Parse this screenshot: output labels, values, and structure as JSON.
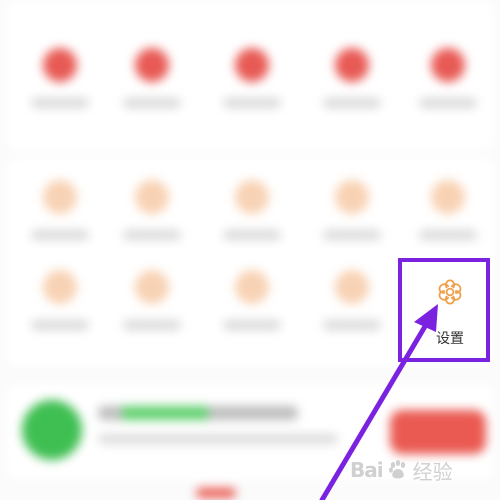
{
  "settings": {
    "label": "设置",
    "icon": "gear-flower-icon",
    "icon_color": "#f0a04b"
  },
  "highlight": {
    "color": "#7b22e0"
  },
  "watermark": {
    "logo_text": "Bai",
    "logo_suffix": "经验",
    "icon": "baidu-paw-icon"
  },
  "colors": {
    "red_icon": "#e85a55",
    "peach_icon": "#f8d2b4",
    "green_circle": "#3fbf52",
    "promo_button": "#ea5a52"
  }
}
